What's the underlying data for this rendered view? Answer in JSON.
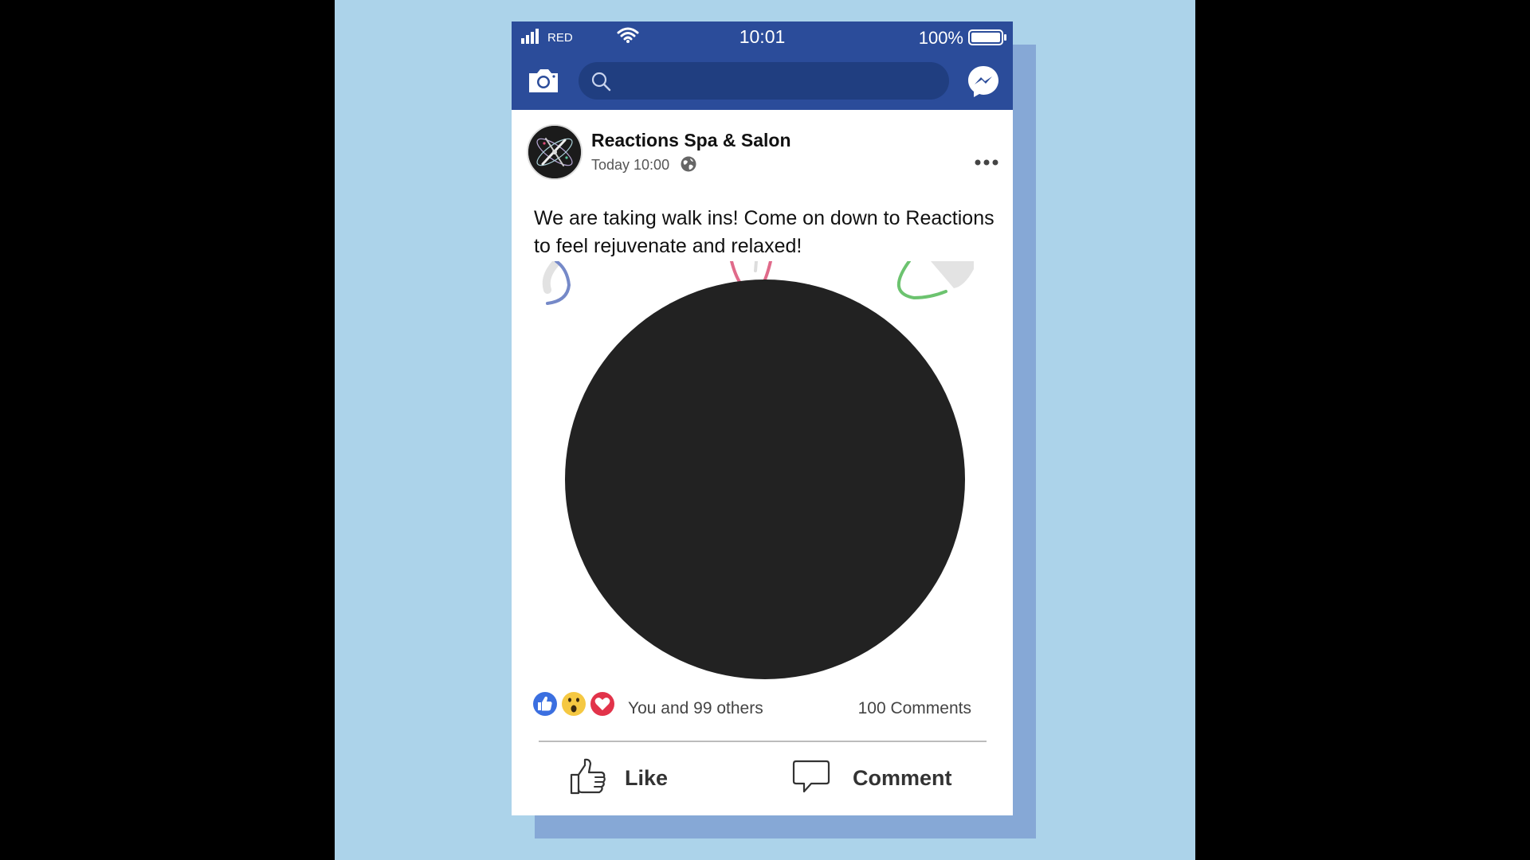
{
  "status_bar": {
    "carrier": "RED",
    "time": "10:01",
    "battery": "100%"
  },
  "nav": {
    "search": {
      "value": "",
      "placeholder": ""
    },
    "icons": [
      "camera-icon",
      "search-icon",
      "messenger-icon"
    ]
  },
  "post": {
    "page_name": "Reactions Spa & Salon",
    "time": "Today 10:00",
    "text": "We are taking walk ins! Come on down to Reactions to feel rejuvenate and relaxed!",
    "reactions_summary": "You and 99 others",
    "reaction_icons": [
      "like-reaction-icon",
      "wow-reaction-icon",
      "love-reaction-icon"
    ],
    "comments_count": "100 Comments",
    "actions": {
      "like": "Like",
      "comment": "Comment"
    }
  },
  "colors": {
    "background": "#acd3ea",
    "brand_blue": "#2b4c9a",
    "search_bar": "#203e80",
    "card_shadow": "#86a8d6",
    "like_blue": "#3b6fe0",
    "love_red": "#e2334a",
    "wow_yellow": "#f5c842"
  }
}
